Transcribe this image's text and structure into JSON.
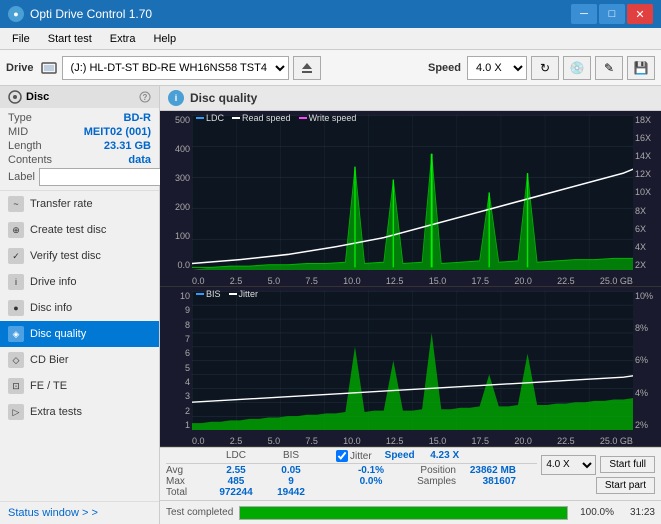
{
  "app": {
    "title": "Opti Drive Control 1.70",
    "title_icon": "●"
  },
  "title_buttons": {
    "minimize": "─",
    "maximize": "□",
    "close": "✕"
  },
  "menu": {
    "items": [
      "File",
      "Start test",
      "Extra",
      "Help"
    ]
  },
  "toolbar": {
    "drive_label": "Drive",
    "drive_value": "(J:) HL-DT-ST BD-RE  WH16NS58 TST4",
    "speed_label": "Speed",
    "speed_value": "4.0 X"
  },
  "sidebar": {
    "disc_section_label": "Disc",
    "disc_fields": {
      "type_label": "Type",
      "type_value": "BD-R",
      "mid_label": "MID",
      "mid_value": "MEIT02 (001)",
      "length_label": "Length",
      "length_value": "23.31 GB",
      "contents_label": "Contents",
      "contents_value": "data",
      "label_label": "Label",
      "label_placeholder": ""
    },
    "items": [
      {
        "id": "transfer-rate",
        "label": "Transfer rate",
        "icon": "~"
      },
      {
        "id": "create-test-disc",
        "label": "Create test disc",
        "icon": "⊕"
      },
      {
        "id": "verify-test-disc",
        "label": "Verify test disc",
        "icon": "✓"
      },
      {
        "id": "drive-info",
        "label": "Drive info",
        "icon": "i"
      },
      {
        "id": "disc-info",
        "label": "Disc info",
        "icon": "●"
      },
      {
        "id": "disc-quality",
        "label": "Disc quality",
        "icon": "◈",
        "active": true
      },
      {
        "id": "cd-bier",
        "label": "CD Bier",
        "icon": "◇"
      },
      {
        "id": "fe-te",
        "label": "FE / TE",
        "icon": "⊡"
      },
      {
        "id": "extra-tests",
        "label": "Extra tests",
        "icon": "▷"
      }
    ],
    "status_window": "Status window > >"
  },
  "disc_quality": {
    "title": "Disc quality",
    "icon": "i",
    "legend": {
      "ldc": "LDC",
      "read_speed": "Read speed",
      "write_speed": "Write speed",
      "bis": "BIS",
      "jitter": "Jitter"
    }
  },
  "chart1": {
    "y_labels_left": [
      "500",
      "400",
      "300",
      "200",
      "100",
      "0.0"
    ],
    "y_labels_right": [
      "18X",
      "16X",
      "14X",
      "12X",
      "10X",
      "8X",
      "6X",
      "4X",
      "2X"
    ],
    "x_labels": [
      "0.0",
      "2.5",
      "5.0",
      "7.5",
      "10.0",
      "12.5",
      "15.0",
      "17.5",
      "20.0",
      "22.5",
      "25.0 GB"
    ]
  },
  "chart2": {
    "y_labels_left": [
      "10",
      "9",
      "8",
      "7",
      "6",
      "5",
      "4",
      "3",
      "2",
      "1"
    ],
    "y_labels_right": [
      "10%",
      "8%",
      "6%",
      "4%",
      "2%"
    ],
    "x_labels": [
      "0.0",
      "2.5",
      "5.0",
      "7.5",
      "10.0",
      "12.5",
      "15.0",
      "17.5",
      "20.0",
      "22.5",
      "25.0 GB"
    ]
  },
  "stats": {
    "headers": [
      "LDC",
      "BIS",
      "",
      "Jitter",
      "Speed",
      ""
    ],
    "avg_label": "Avg",
    "avg_ldc": "2.55",
    "avg_bis": "0.05",
    "avg_jitter": "-0.1%",
    "max_label": "Max",
    "max_ldc": "485",
    "max_bis": "9",
    "max_jitter": "0.0%",
    "total_label": "Total",
    "total_ldc": "972244",
    "total_bis": "19442",
    "speed_label": "Speed",
    "speed_value": "4.23 X",
    "position_label": "Position",
    "position_value": "23862 MB",
    "samples_label": "Samples",
    "samples_value": "381607",
    "speed_dropdown": "4.0 X",
    "jitter_checked": true,
    "jitter_label": "Jitter"
  },
  "buttons": {
    "start_full": "Start full",
    "start_part": "Start part"
  },
  "progress": {
    "status": "Test completed",
    "percent": "100.0%",
    "fill_width": 100,
    "time": "31:23"
  }
}
